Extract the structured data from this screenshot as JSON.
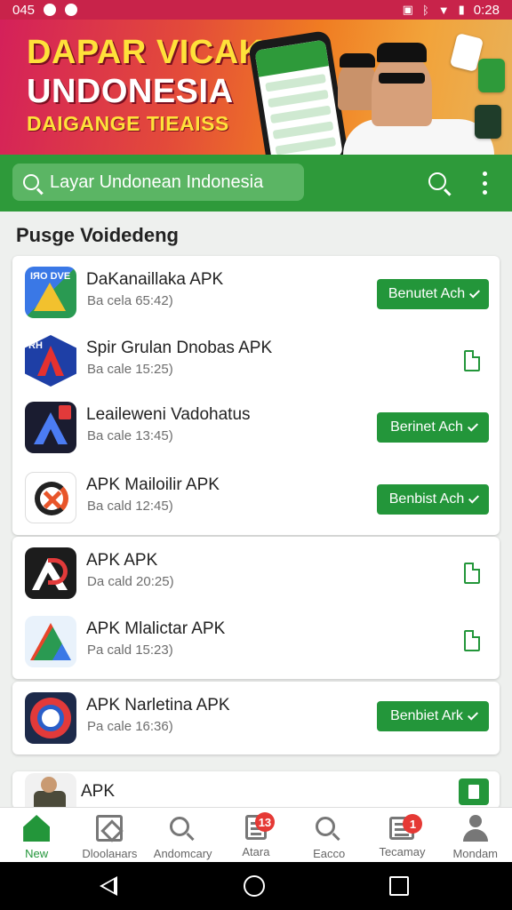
{
  "status_bar": {
    "time_left": "045",
    "time_right": "0:28"
  },
  "banner": {
    "line1": "DAPAR VICAKIN",
    "line2": "UNDONESIA",
    "line3": "DAIGANGE TIEAISS"
  },
  "search": {
    "text": "Layar Undonean Indonesia"
  },
  "section_title": "Pusge Voidedeng",
  "apps": [
    {
      "name": "DaKanaillaka APK",
      "meta": "Ba cela 65:42)",
      "action": "Benutet Ach",
      "icon": "drive-icon",
      "icon_text": "IЯО DVE"
    },
    {
      "name": "Spir Grulan Dnobas APK",
      "meta": "Ba cale 15:25)",
      "action": "",
      "icon": "spir-icon",
      "icon_text": "RH"
    },
    {
      "name": "Leaileweni Vadohatus",
      "meta": "Ba cale 13:45)",
      "action": "Berinet Ach",
      "icon": "lea-icon"
    },
    {
      "name": "APK Mailoilir APK",
      "meta": "Ba cald 12:45)",
      "action": "Benbist Ach",
      "icon": "mail-icon"
    },
    {
      "name": "APK APK",
      "meta": "Da cald 20:25)",
      "action": "",
      "icon": "apk-icon"
    },
    {
      "name": "APK Mlalictar APK",
      "meta": "Pa cald 15:23)",
      "action": "",
      "icon": "mal-icon"
    },
    {
      "name": "APK Narletina APK",
      "meta": "Pa cale 16:36)",
      "action": "Benbiet Ark",
      "icon": "nar-icon"
    },
    {
      "name": "APK",
      "meta": "",
      "action": "",
      "icon": "war-icon"
    }
  ],
  "bottom_nav": [
    {
      "label": "New",
      "icon": "home-icon",
      "badge": ""
    },
    {
      "label": "Dloolaнars",
      "icon": "downloads-icon",
      "badge": ""
    },
    {
      "label": "Andomcary",
      "icon": "search-icon",
      "badge": ""
    },
    {
      "label": "Atara",
      "icon": "doc-icon",
      "badge": "13"
    },
    {
      "label": "Eacco",
      "icon": "search-icon",
      "badge": ""
    },
    {
      "label": "Tecamay",
      "icon": "calendar-icon",
      "badge": "1"
    },
    {
      "label": "Mondam",
      "icon": "person-icon",
      "badge": ""
    }
  ],
  "colors": {
    "brand_green": "#23963a",
    "header_green": "#2e9a3a",
    "status_red": "#c8234a",
    "badge_red": "#e53935"
  }
}
